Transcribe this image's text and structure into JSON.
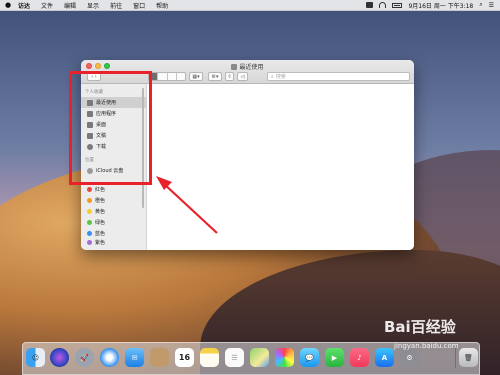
{
  "menubar": {
    "app_name": "访达",
    "items": [
      "文件",
      "编辑",
      "显示",
      "前往",
      "窗口",
      "帮助"
    ],
    "clock": "9月16日 周一 下午3:18"
  },
  "window": {
    "title": "最近使用",
    "search_placeholder": "搜索",
    "sidebar": {
      "section_favorites": "个人收藏",
      "favorites": [
        {
          "label": "最近使用",
          "icon": "clock-icon",
          "selected": true
        },
        {
          "label": "应用程序",
          "icon": "applications-icon"
        },
        {
          "label": "桌面",
          "icon": "desktop-icon"
        },
        {
          "label": "文稿",
          "icon": "documents-icon"
        },
        {
          "label": "下载",
          "icon": "downloads-icon"
        }
      ],
      "section_locations": "位置",
      "locations": [
        {
          "label": "iCloud 云盘",
          "icon": "icloud-icon"
        }
      ],
      "tags": [
        {
          "label": "红色",
          "color": "#e8453c"
        },
        {
          "label": "橙色",
          "color": "#f39a26"
        },
        {
          "label": "黄色",
          "color": "#f3cf2a"
        },
        {
          "label": "绿色",
          "color": "#5bc545"
        },
        {
          "label": "蓝色",
          "color": "#3a8ff0"
        },
        {
          "label": "紫色",
          "color": "#a86ad8"
        }
      ]
    }
  },
  "annotation": {
    "highlight_color": "#e8212a"
  },
  "dock": {
    "calendar_day": "16",
    "icons": [
      "finder-icon",
      "siri-icon",
      "launchpad-icon",
      "safari-icon",
      "mail-icon",
      "contacts-icon",
      "calendar-icon",
      "notes-icon",
      "reminders-icon",
      "maps-icon",
      "photos-icon",
      "messages-icon",
      "facetime-icon",
      "music-icon",
      "app-store-icon",
      "system-preferences-icon",
      "trash-icon"
    ]
  },
  "watermark": {
    "brand": "Bai百经验",
    "url": "jingyan.baidu.com"
  }
}
